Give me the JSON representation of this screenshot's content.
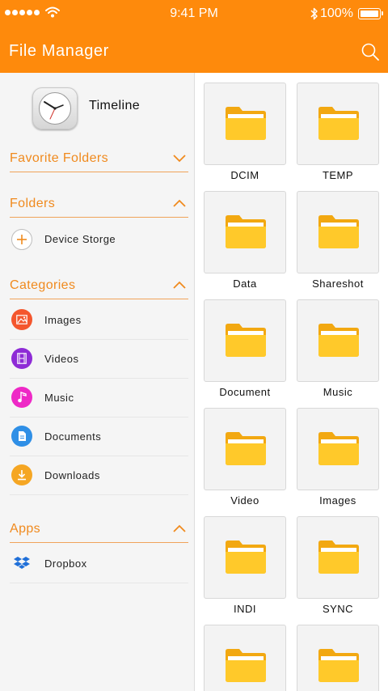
{
  "status_bar": {
    "time": "9:41 PM",
    "battery": "100%"
  },
  "app_bar": {
    "title": "File Manager"
  },
  "sidebar": {
    "timeline_label": "Timeline",
    "favorite_folders": {
      "title": "Favorite Folders",
      "state": "collapsed"
    },
    "folders": {
      "title": "Folders",
      "state": "expanded",
      "items": [
        {
          "label": "Device Storge",
          "icon": "plus-icon"
        }
      ]
    },
    "categories": {
      "title": "Categories",
      "state": "expanded",
      "items": [
        {
          "label": "Images",
          "icon": "image-icon",
          "color": "#f4562d"
        },
        {
          "label": "Videos",
          "icon": "film-icon",
          "color": "#8e2bd6"
        },
        {
          "label": "Music",
          "icon": "music-note-icon",
          "color": "#ee29c6"
        },
        {
          "label": "Documents",
          "icon": "document-icon",
          "color": "#2f8fe6"
        },
        {
          "label": "Downloads",
          "icon": "download-icon",
          "color": "#f5a623"
        }
      ]
    },
    "apps": {
      "title": "Apps",
      "state": "expanded",
      "items": [
        {
          "label": "Dropbox",
          "icon": "dropbox-icon",
          "color": "#1f6fd8"
        }
      ]
    }
  },
  "grid": {
    "folders": [
      {
        "label": "DCIM"
      },
      {
        "label": "TEMP"
      },
      {
        "label": "Data"
      },
      {
        "label": "Shareshot"
      },
      {
        "label": "Document"
      },
      {
        "label": "Music"
      },
      {
        "label": "Video"
      },
      {
        "label": "Images"
      },
      {
        "label": "INDI"
      },
      {
        "label": "SYNC"
      },
      {
        "label": ""
      },
      {
        "label": ""
      }
    ]
  },
  "colors": {
    "accent": "#fe8a0c",
    "section_title": "#f08a1e",
    "folder": "#ffc92a",
    "folder_back": "#f2a811"
  }
}
